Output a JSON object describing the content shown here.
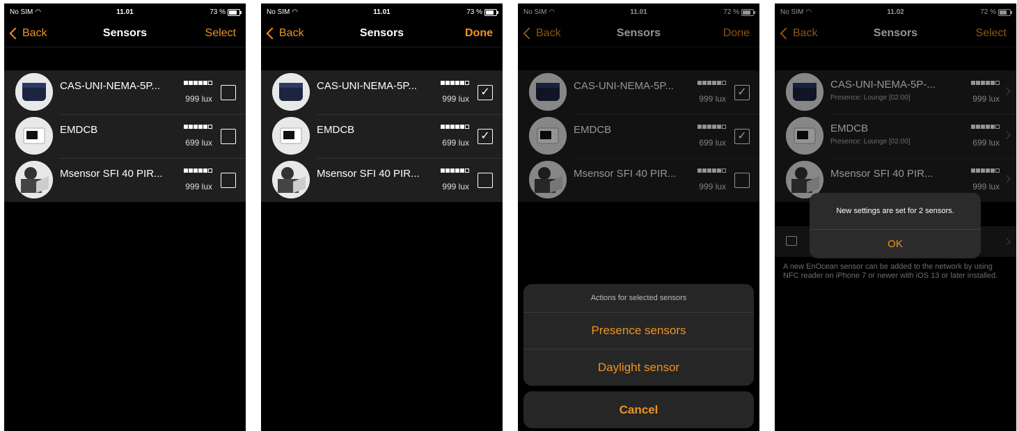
{
  "colors": {
    "accent": "#f0931e",
    "background": "#000000",
    "cell": "#1f1f1f"
  },
  "screens": [
    {
      "status": {
        "carrier": "No SIM",
        "time": "11.01",
        "battery": "73 %"
      },
      "nav": {
        "back": "Back",
        "title": "Sensors",
        "right": "Select"
      },
      "rows": [
        {
          "name": "CAS-UNI-NEMA-5P...",
          "lux": "999 lux",
          "signal": 5,
          "checked": false
        },
        {
          "name": "EMDCB",
          "lux": "699 lux",
          "signal": 5,
          "checked": false
        },
        {
          "name": "Msensor SFI 40 PIR...",
          "lux": "999 lux",
          "signal": 5,
          "checked": false
        }
      ]
    },
    {
      "status": {
        "carrier": "No SIM",
        "time": "11.01",
        "battery": "73 %"
      },
      "nav": {
        "back": "Back",
        "title": "Sensors",
        "right": "Done"
      },
      "rows": [
        {
          "name": "CAS-UNI-NEMA-5P...",
          "lux": "999 lux",
          "signal": 5,
          "checked": true
        },
        {
          "name": "EMDCB",
          "lux": "699 lux",
          "signal": 5,
          "checked": true
        },
        {
          "name": "Msensor SFI 40 PIR...",
          "lux": "999 lux",
          "signal": 5,
          "checked": false
        }
      ]
    },
    {
      "status": {
        "carrier": "No SIM",
        "time": "11.01",
        "battery": "72 %"
      },
      "nav": {
        "back": "Back",
        "title": "Sensors",
        "right": "Done"
      },
      "rows": [
        {
          "name": "CAS-UNI-NEMA-5P...",
          "lux": "999 lux",
          "signal": 5,
          "checked": true
        },
        {
          "name": "EMDCB",
          "lux": "699 lux",
          "signal": 5,
          "checked": true
        },
        {
          "name": "Msensor SFI 40 PIR...",
          "lux": "999 lux",
          "signal": 5,
          "checked": false
        }
      ],
      "action_sheet": {
        "header": "Actions for selected sensors",
        "actions": [
          "Presence sensors",
          "Daylight sensor"
        ],
        "cancel": "Cancel"
      }
    },
    {
      "status": {
        "carrier": "No SIM",
        "time": "11.02",
        "battery": "72 %"
      },
      "nav": {
        "back": "Back",
        "title": "Sensors",
        "right": "Select"
      },
      "rows": [
        {
          "name": "CAS-UNI-NEMA-5P-...",
          "sub": "Presence: Lounge [02:00]",
          "lux": "999 lux",
          "signal": 5
        },
        {
          "name": "EMDCB",
          "sub": "Presence: Lounge [02:00]",
          "lux": "699 lux",
          "signal": 5
        },
        {
          "name": "Msensor SFI 40 PIR...",
          "lux": "999 lux",
          "signal": 5
        }
      ],
      "footer": "A new EnOcean sensor can be added to the network by using NFC reader on iPhone 7 or newer with iOS 13 or later installed.",
      "alert": {
        "message": "New settings are set for 2 sensors.",
        "ok": "OK"
      }
    }
  ]
}
